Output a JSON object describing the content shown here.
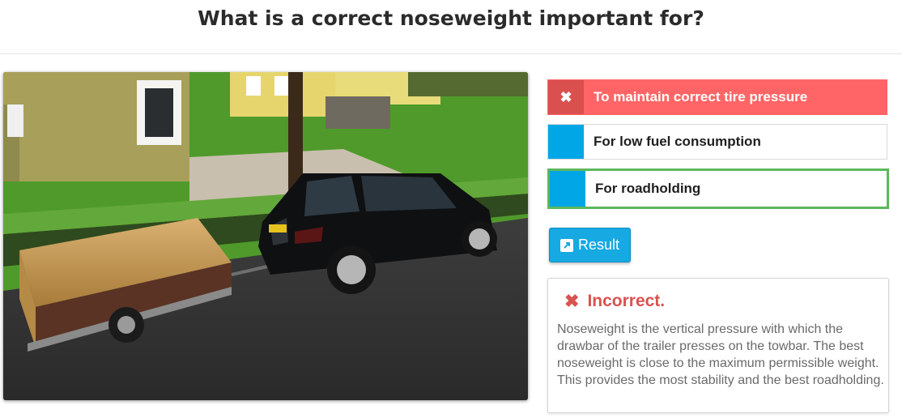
{
  "question": "What is a correct noseweight important for?",
  "answers": [
    {
      "label": "To maintain correct tire pressure",
      "state": "wrong",
      "marker_icon": "✖"
    },
    {
      "label": "For low fuel consumption",
      "state": "neutral",
      "marker_icon": ""
    },
    {
      "label": "For roadholding",
      "state": "correct",
      "marker_icon": ""
    }
  ],
  "result_button": {
    "label": "Result",
    "icon": "external-link-icon"
  },
  "feedback": {
    "icon": "✖",
    "verdict": "Incorrect.",
    "explanation": "Noseweight is the vertical pressure with which the drawbar of the trailer presses on the towbar. The best noseweight is close to the maximum permissible weight. This provides the most stability and the best roadholding."
  },
  "colors": {
    "accent": "#00a6e6",
    "wrong": "#ff6566",
    "correct_border": "#5cb85c",
    "error_text": "#d9534f"
  }
}
